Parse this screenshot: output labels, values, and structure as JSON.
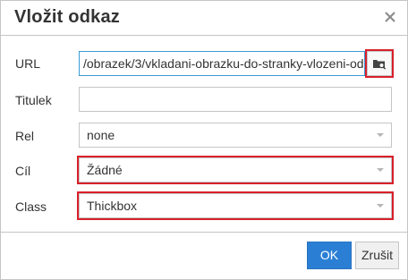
{
  "dialog": {
    "title": "Vložit odkaz",
    "close_icon": "close-icon"
  },
  "fields": {
    "url": {
      "label": "URL",
      "value": "/obrazek/3/vkladani-obrazku-do-stranky-vlozeni-od",
      "browse_icon": "folder-search-icon"
    },
    "titulek": {
      "label": "Titulek",
      "value": ""
    },
    "rel": {
      "label": "Rel",
      "value": "none"
    },
    "cil": {
      "label": "Cíl",
      "value": "Žádné"
    },
    "class": {
      "label": "Class",
      "value": "Thickbox"
    }
  },
  "buttons": {
    "ok_label": "OK",
    "cancel_label": "Zrušit"
  },
  "colors": {
    "primary": "#2a7fd5",
    "highlight": "#d9202a",
    "focus_border": "#3a9bd5"
  }
}
